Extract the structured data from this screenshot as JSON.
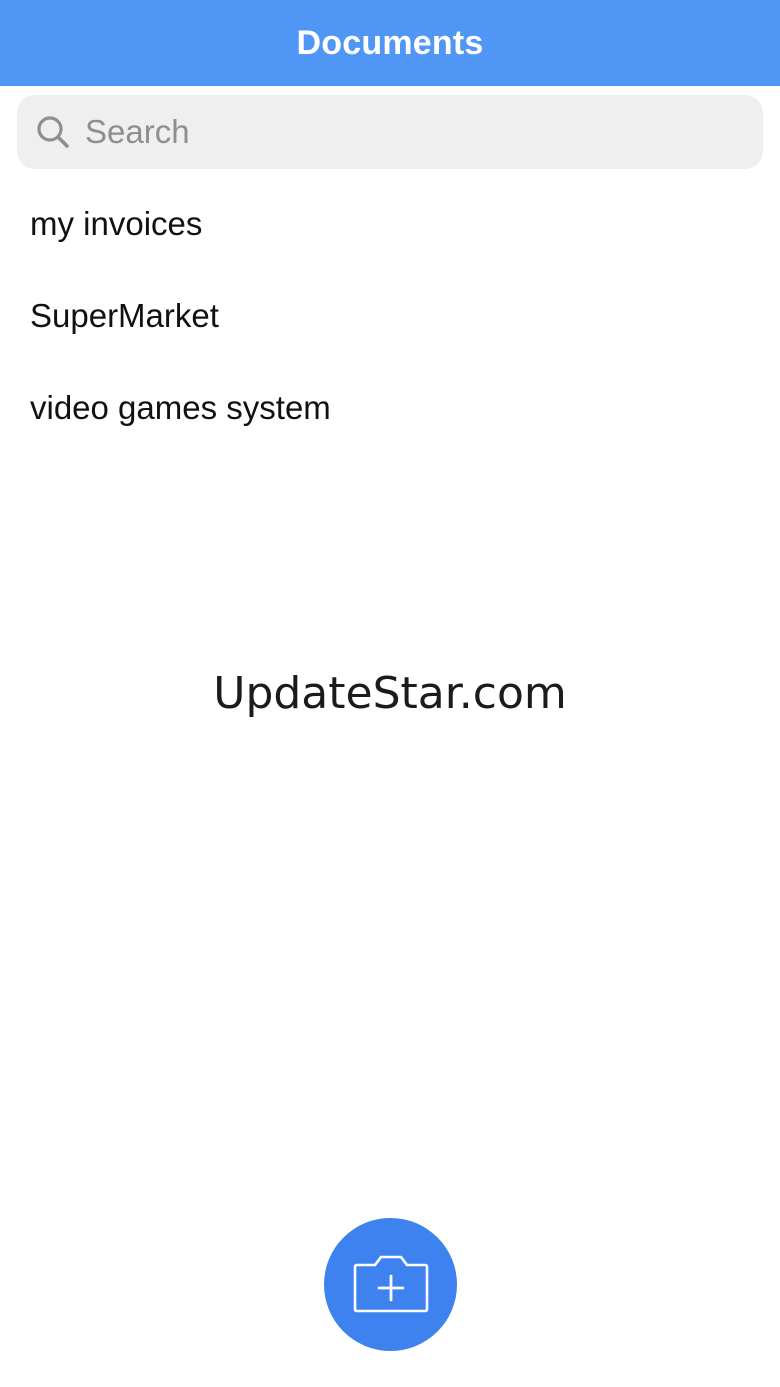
{
  "header": {
    "title": "Documents"
  },
  "search": {
    "placeholder": "Search",
    "value": ""
  },
  "documents": [
    {
      "label": "my invoices"
    },
    {
      "label": "SuperMarket"
    },
    {
      "label": "video games system"
    }
  ],
  "watermark": "UpdateStar.com",
  "fab": {
    "icon": "camera-add-icon"
  },
  "colors": {
    "header_bg": "#5096f4",
    "fab_bg": "#3d82ee",
    "search_bg": "#efefef"
  }
}
